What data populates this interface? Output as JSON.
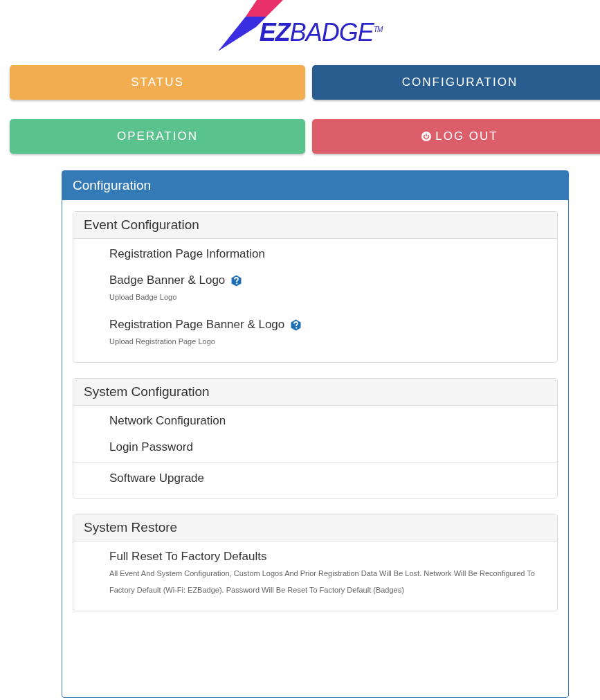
{
  "logo": {
    "brand_bold": "EZ",
    "brand": "BADGE",
    "trademark": "TM"
  },
  "nav": [
    {
      "label": "STATUS",
      "color": "#f0a742",
      "selected": false
    },
    {
      "label": "CONFIGURATION",
      "color": "#2a5d8f",
      "selected": true
    },
    {
      "label": "OPERATION",
      "color": "#4dbd84",
      "selected": false
    },
    {
      "label": "LOG OUT",
      "color": "#d9515e",
      "selected": false,
      "kind": "power"
    }
  ],
  "panel": {
    "title": "Configuration",
    "sections": [
      {
        "title": "Event Configuration",
        "items": [
          {
            "label": "Registration Page Information",
            "help": false
          },
          {
            "label": "Badge Banner & Logo",
            "help": true,
            "note": "Upload Badge Logo"
          },
          {
            "label": "Registration Page Banner & Logo",
            "help": true,
            "note": "Upload Registration Page Logo"
          }
        ]
      },
      {
        "title": "System Configuration",
        "items": [
          {
            "label": "Network Configuration",
            "help": false
          },
          {
            "label": "Login Password",
            "help": false
          },
          {
            "label": "Software Upgrade",
            "help": false,
            "divider": true
          }
        ]
      },
      {
        "title": "System Restore",
        "items": [
          {
            "label": "Full Reset To Factory Defaults",
            "help": false,
            "note": "All Event And System Configuration, Custom Logos And Prior Registration Data Will Be Lost. Network Will Be Reconfigured To Factory Default (Wi-Fi: EZBadge). Password Will Be Reset To Factory Default (Badges)"
          }
        ]
      }
    ]
  }
}
